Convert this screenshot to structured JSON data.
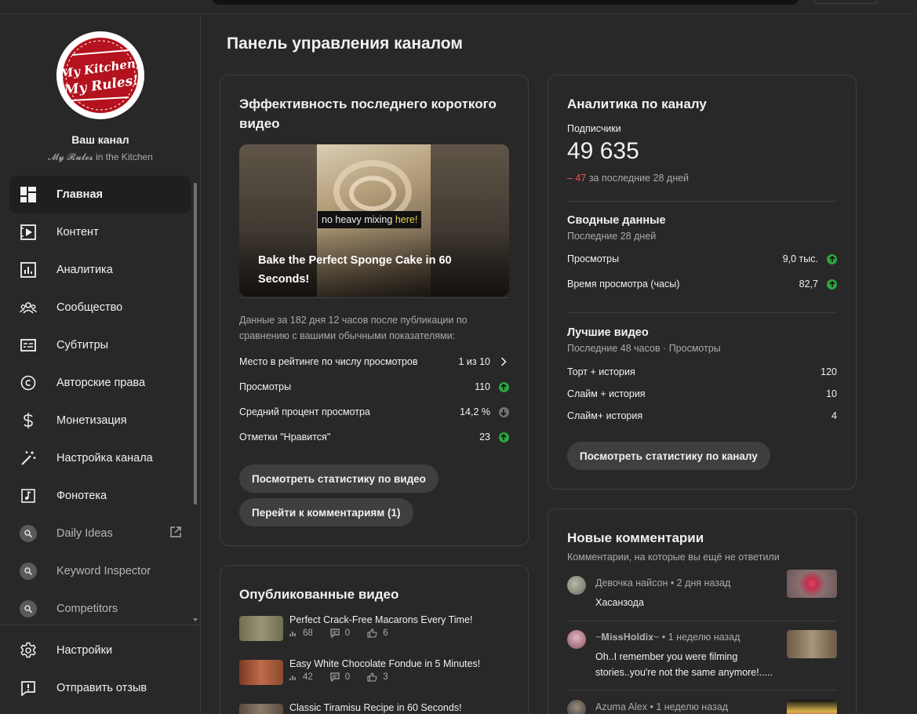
{
  "sidebar": {
    "channel_title": "Ваш канал",
    "channel_handle": "𝓜𝔂 𝓡𝓾𝓵𝓮𝓼 in the Kitchen",
    "logo_text_line1": "My Kitchen,",
    "logo_text_line2": "My Rules!",
    "items": [
      {
        "label": "Главная",
        "icon": "dashboard-icon"
      },
      {
        "label": "Контент",
        "icon": "content-icon"
      },
      {
        "label": "Аналитика",
        "icon": "analytics-icon"
      },
      {
        "label": "Сообщество",
        "icon": "community-icon"
      },
      {
        "label": "Субтитры",
        "icon": "subtitles-icon"
      },
      {
        "label": "Авторские права",
        "icon": "copyright-icon"
      },
      {
        "label": "Монетизация",
        "icon": "monetization-icon"
      },
      {
        "label": "Настройка канала",
        "icon": "customization-icon"
      },
      {
        "label": "Фонотека",
        "icon": "audio-library-icon"
      },
      {
        "label": "Daily Ideas",
        "icon": "extension-icon"
      },
      {
        "label": "Keyword Inspector",
        "icon": "extension-icon"
      },
      {
        "label": "Competitors",
        "icon": "extension-icon"
      }
    ],
    "bottom_items": [
      {
        "label": "Настройки",
        "icon": "settings-icon"
      },
      {
        "label": "Отправить отзыв",
        "icon": "feedback-icon"
      }
    ]
  },
  "page_title": "Панель управления каналом",
  "latest_short": {
    "title": "Эффективность последнего короткого видео",
    "thumb_caption_a": "no heavy mixing ",
    "thumb_caption_b": "here!",
    "video_title": "Bake the Perfect Sponge Cake in 60 Seconds!",
    "description": "Данные за 182 дня 12 часов после публикации по сравнению с вашими обычными показателями:",
    "rows": [
      {
        "label": "Место в рейтинге по числу просмотров",
        "value": "1 из 10",
        "indicator": "chevron"
      },
      {
        "label": "Просмотры",
        "value": "110",
        "indicator": "up"
      },
      {
        "label": "Средний процент просмотра",
        "value": "14,2 %",
        "indicator": "down"
      },
      {
        "label": "Отметки \"Нравится\"",
        "value": "23",
        "indicator": "up"
      }
    ],
    "btn_stats": "Посмотреть статистику по видео",
    "btn_comments": "Перейти к комментариям (1)"
  },
  "published": {
    "title": "Опубликованные видео",
    "videos": [
      {
        "title": "Perfect Crack-Free Macarons Every Time!",
        "views": "68",
        "comments": "0",
        "likes": "6",
        "color": "#7b7b5c"
      },
      {
        "title": "Easy White Chocolate Fondue in 5 Minutes!",
        "views": "42",
        "comments": "0",
        "likes": "3",
        "color": "#8a4a32"
      },
      {
        "title": "Classic Tiramisu Recipe in 60 Seconds!",
        "views": "",
        "comments": "",
        "likes": "",
        "color": "#6b5c4e"
      }
    ]
  },
  "analytics": {
    "title": "Аналитика по каналу",
    "subs_label": "Подписчики",
    "subs_value": "49 635",
    "subs_delta": "– 47",
    "subs_delta_suffix": "за последние 28 дней",
    "summary_title": "Сводные данные",
    "summary_period": "Последние 28 дней",
    "summary_rows": [
      {
        "label": "Просмотры",
        "value": "9,0 тыс."
      },
      {
        "label": "Время просмотра (часы)",
        "value": "82,7"
      }
    ],
    "top_title": "Лучшие видео",
    "top_period": "Последние 48 часов · Просмотры",
    "top_rows": [
      {
        "label": "Торт + история",
        "value": "120"
      },
      {
        "label": "Слайм + история",
        "value": "10"
      },
      {
        "label": "Слайм+ история",
        "value": "4"
      }
    ],
    "btn": "Посмотреть статистику по каналу"
  },
  "comments": {
    "title": "Новые комментарии",
    "subtitle": "Комментарии, на которые вы ещё не ответили",
    "items": [
      {
        "author": "Девочка найсон • 2 дня назад",
        "text": "Хасанзода",
        "avatar_color": "#8a8a7a",
        "thumb_color": "#6f5a5a"
      },
      {
        "author": "~𝐌𝐢𝐬𝐬𝐇𝐨𝐥𝐝𝐢𝐱~ • 1 неделю назад",
        "text": "Oh..I remember you were filming stories..you're not the same anymore!.....",
        "avatar_color": "#b07a80",
        "thumb_color": "#7a6a58"
      },
      {
        "author": "Azuma Alex • 1 неделю назад",
        "text": "",
        "avatar_color": "#4a4a4a",
        "thumb_color": "#1a1a1a"
      }
    ]
  },
  "colors": {
    "accent_up": "#2ba640",
    "delta_red": "#ff4e45"
  }
}
